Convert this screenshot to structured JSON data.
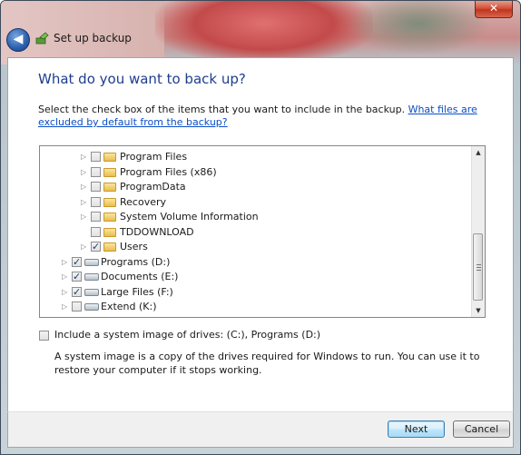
{
  "window": {
    "close_glyph": "✕",
    "back_glyph": "◀",
    "title": "Set up backup"
  },
  "page": {
    "heading": "What do you want to back up?",
    "instruction": "Select the check box of the items that you want to include in the backup.",
    "instruction_link": "What files are excluded by default from the backup?"
  },
  "tree": {
    "items": [
      {
        "label": "Program Files",
        "checked": false,
        "type": "folder",
        "expander": true
      },
      {
        "label": "Program Files (x86)",
        "checked": false,
        "type": "folder",
        "expander": true
      },
      {
        "label": "ProgramData",
        "checked": false,
        "type": "folder",
        "expander": true
      },
      {
        "label": "Recovery",
        "checked": false,
        "type": "folder",
        "expander": true
      },
      {
        "label": "System Volume Information",
        "checked": false,
        "type": "folder",
        "expander": true
      },
      {
        "label": "TDDOWNLOAD",
        "checked": false,
        "type": "folder",
        "expander": false
      },
      {
        "label": "Users",
        "checked": true,
        "type": "folder",
        "expander": true
      },
      {
        "label": "Programs (D:)",
        "checked": true,
        "type": "drive",
        "expander": true
      },
      {
        "label": "Documents (E:)",
        "checked": true,
        "type": "drive",
        "expander": true
      },
      {
        "label": "Large Files (F:)",
        "checked": true,
        "type": "drive",
        "expander": true
      },
      {
        "label": "Extend (K:)",
        "checked": false,
        "type": "drive",
        "expander": true
      }
    ]
  },
  "system_image": {
    "label": "Include a system image of drives: (C:), Programs (D:)",
    "checked": false,
    "description": "A system image is a copy of the drives required for Windows to run. You can use it to restore your computer if it stops working."
  },
  "footer": {
    "next_label": "Next",
    "cancel_label": "Cancel"
  },
  "colors": {
    "heading": "#1e3d8f",
    "link": "#0b4ec6"
  }
}
